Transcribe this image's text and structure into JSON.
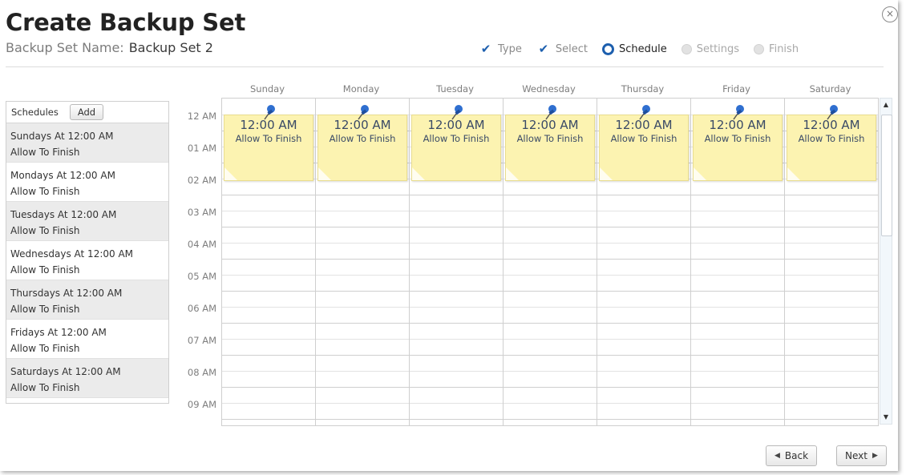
{
  "dialog": {
    "title": "Create Backup Set",
    "close_glyph": "×"
  },
  "backup_set": {
    "label": "Backup Set Name:",
    "value": "Backup Set 2"
  },
  "steps": [
    {
      "label": "Type",
      "state": "done"
    },
    {
      "label": "Select",
      "state": "done"
    },
    {
      "label": "Schedule",
      "state": "current"
    },
    {
      "label": "Settings",
      "state": "future"
    },
    {
      "label": "Finish",
      "state": "future"
    }
  ],
  "schedules": {
    "header": "Schedules",
    "add_label": "Add",
    "items": [
      {
        "line1": "Sundays At 12:00 AM",
        "line2": "Allow To Finish"
      },
      {
        "line1": "Mondays At 12:00 AM",
        "line2": "Allow To Finish"
      },
      {
        "line1": "Tuesdays At 12:00 AM",
        "line2": "Allow To Finish"
      },
      {
        "line1": "Wednesdays At 12:00 AM",
        "line2": "Allow To Finish"
      },
      {
        "line1": "Thursdays At 12:00 AM",
        "line2": "Allow To Finish"
      },
      {
        "line1": "Fridays At 12:00 AM",
        "line2": "Allow To Finish"
      },
      {
        "line1": "Saturdays At 12:00 AM",
        "line2": "Allow To Finish"
      }
    ]
  },
  "calendar": {
    "days": [
      "Sunday",
      "Monday",
      "Tuesday",
      "Wednesday",
      "Thursday",
      "Friday",
      "Saturday"
    ],
    "hours": [
      "12 AM",
      "01 AM",
      "02 AM",
      "03 AM",
      "04 AM",
      "05 AM",
      "06 AM",
      "07 AM",
      "08 AM",
      "09 AM"
    ],
    "events": [
      {
        "day": "Sunday",
        "time": "12:00 AM",
        "label": "Allow To Finish"
      },
      {
        "day": "Monday",
        "time": "12:00 AM",
        "label": "Allow To Finish"
      },
      {
        "day": "Tuesday",
        "time": "12:00 AM",
        "label": "Allow To Finish"
      },
      {
        "day": "Wednesday",
        "time": "12:00 AM",
        "label": "Allow To Finish"
      },
      {
        "day": "Thursday",
        "time": "12:00 AM",
        "label": "Allow To Finish"
      },
      {
        "day": "Friday",
        "time": "12:00 AM",
        "label": "Allow To Finish"
      },
      {
        "day": "Saturday",
        "time": "12:00 AM",
        "label": "Allow To Finish"
      }
    ],
    "event_color": "#fcf3b1",
    "pin_icon": "pushpin-icon"
  },
  "footer": {
    "back_label": "Back",
    "next_label": "Next"
  },
  "colors": {
    "accent": "#1d5fae",
    "alt_row": "#ebebeb"
  }
}
